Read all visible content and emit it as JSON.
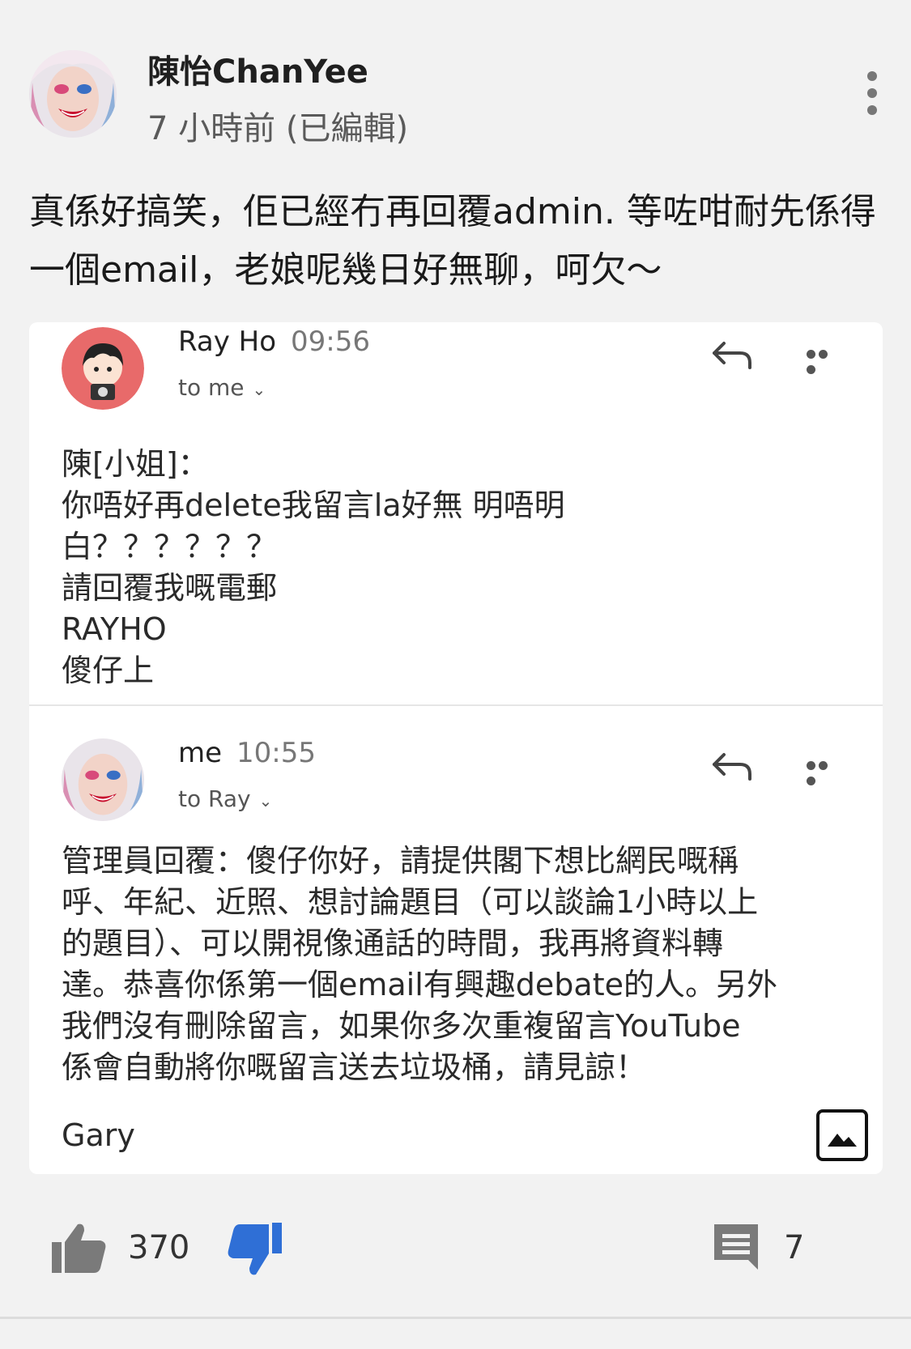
{
  "comment": {
    "author": "陳怡ChanYee",
    "timestamp": "7 小時前 (已編輯)",
    "text": "真係好搞笑，佢已經冇再回覆admin. 等咗咁耐先係得一個email，老娘呢幾日好無聊，呵欠～"
  },
  "emails": [
    {
      "sender": "Ray Ho",
      "time": "09:56",
      "recipient": "to me",
      "body": "陳[小姐]：\n你唔好再delete我留言la好無 明唔明\n白？？？？？？\n請回覆我嘅電郵\nRAYHO\n傻仔上"
    },
    {
      "sender": "me",
      "time": "10:55",
      "recipient": "to Ray",
      "body": "管理員回覆：傻仔你好，請提供閣下想比網民嘅稱\n呼、年紀、近照、想討論題目（可以談論1小時以上\n的題目）、可以開視像通話的時間，我再將資料轉\n達。恭喜你係第一個email有興趣debate的人。另外\n我們沒有刪除留言，如果你多次重複留言YouTube\n係會自動將你嘅留言送去垃圾桶，請見諒！",
      "signature": "Gary"
    }
  ],
  "actions": {
    "like_count": "370",
    "reply_count": "7"
  },
  "colors": {
    "background": "#f2f2f2",
    "card": "#ffffff",
    "dislike_active": "#2f6fd6",
    "icon_gray": "#777777"
  },
  "icons": [
    "more-vert-icon",
    "reply-arrow-icon",
    "more-horiz-icon",
    "thumb-up-icon",
    "thumb-down-icon",
    "comment-icon",
    "image-icon"
  ]
}
